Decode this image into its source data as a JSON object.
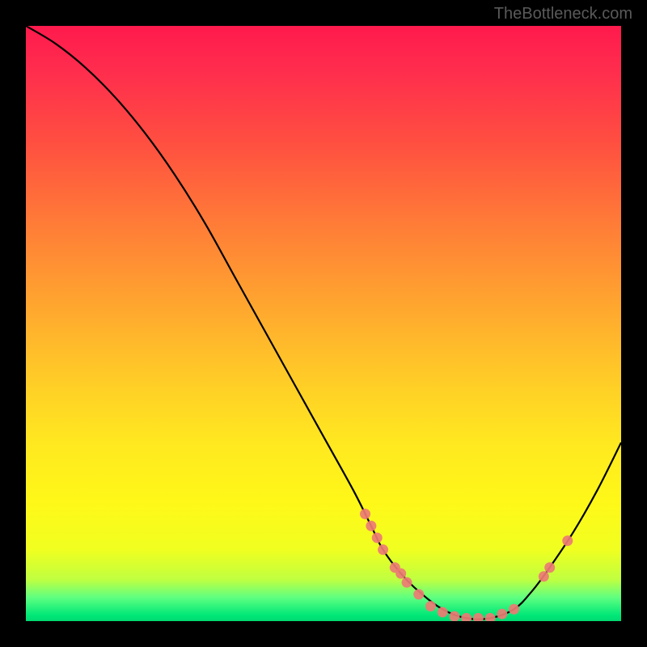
{
  "watermark": "TheBottleneck.com",
  "chart_data": {
    "type": "line",
    "title": "",
    "xlabel": "",
    "ylabel": "",
    "xlim": [
      0,
      100
    ],
    "ylim": [
      0,
      100
    ],
    "curve": {
      "x": [
        0,
        5,
        10,
        15,
        20,
        25,
        30,
        35,
        40,
        45,
        50,
        55,
        58,
        60,
        63,
        66,
        70,
        74,
        78,
        82,
        85,
        88,
        92,
        96,
        100
      ],
      "y": [
        100,
        97,
        93,
        88,
        82,
        75,
        67,
        58,
        49,
        40,
        31,
        22,
        16,
        12,
        8,
        5,
        2,
        0.5,
        0.5,
        2,
        5,
        9,
        15,
        22,
        30
      ]
    },
    "markers": [
      {
        "x": 57,
        "y": 18
      },
      {
        "x": 58,
        "y": 16
      },
      {
        "x": 59,
        "y": 14
      },
      {
        "x": 60,
        "y": 12
      },
      {
        "x": 62,
        "y": 9
      },
      {
        "x": 63,
        "y": 8
      },
      {
        "x": 64,
        "y": 6.5
      },
      {
        "x": 66,
        "y": 4.5
      },
      {
        "x": 68,
        "y": 2.5
      },
      {
        "x": 70,
        "y": 1.5
      },
      {
        "x": 72,
        "y": 0.8
      },
      {
        "x": 74,
        "y": 0.5
      },
      {
        "x": 76,
        "y": 0.5
      },
      {
        "x": 78,
        "y": 0.5
      },
      {
        "x": 80,
        "y": 1.2
      },
      {
        "x": 82,
        "y": 2
      },
      {
        "x": 87,
        "y": 7.5
      },
      {
        "x": 88,
        "y": 9
      },
      {
        "x": 91,
        "y": 13.5
      }
    ]
  }
}
